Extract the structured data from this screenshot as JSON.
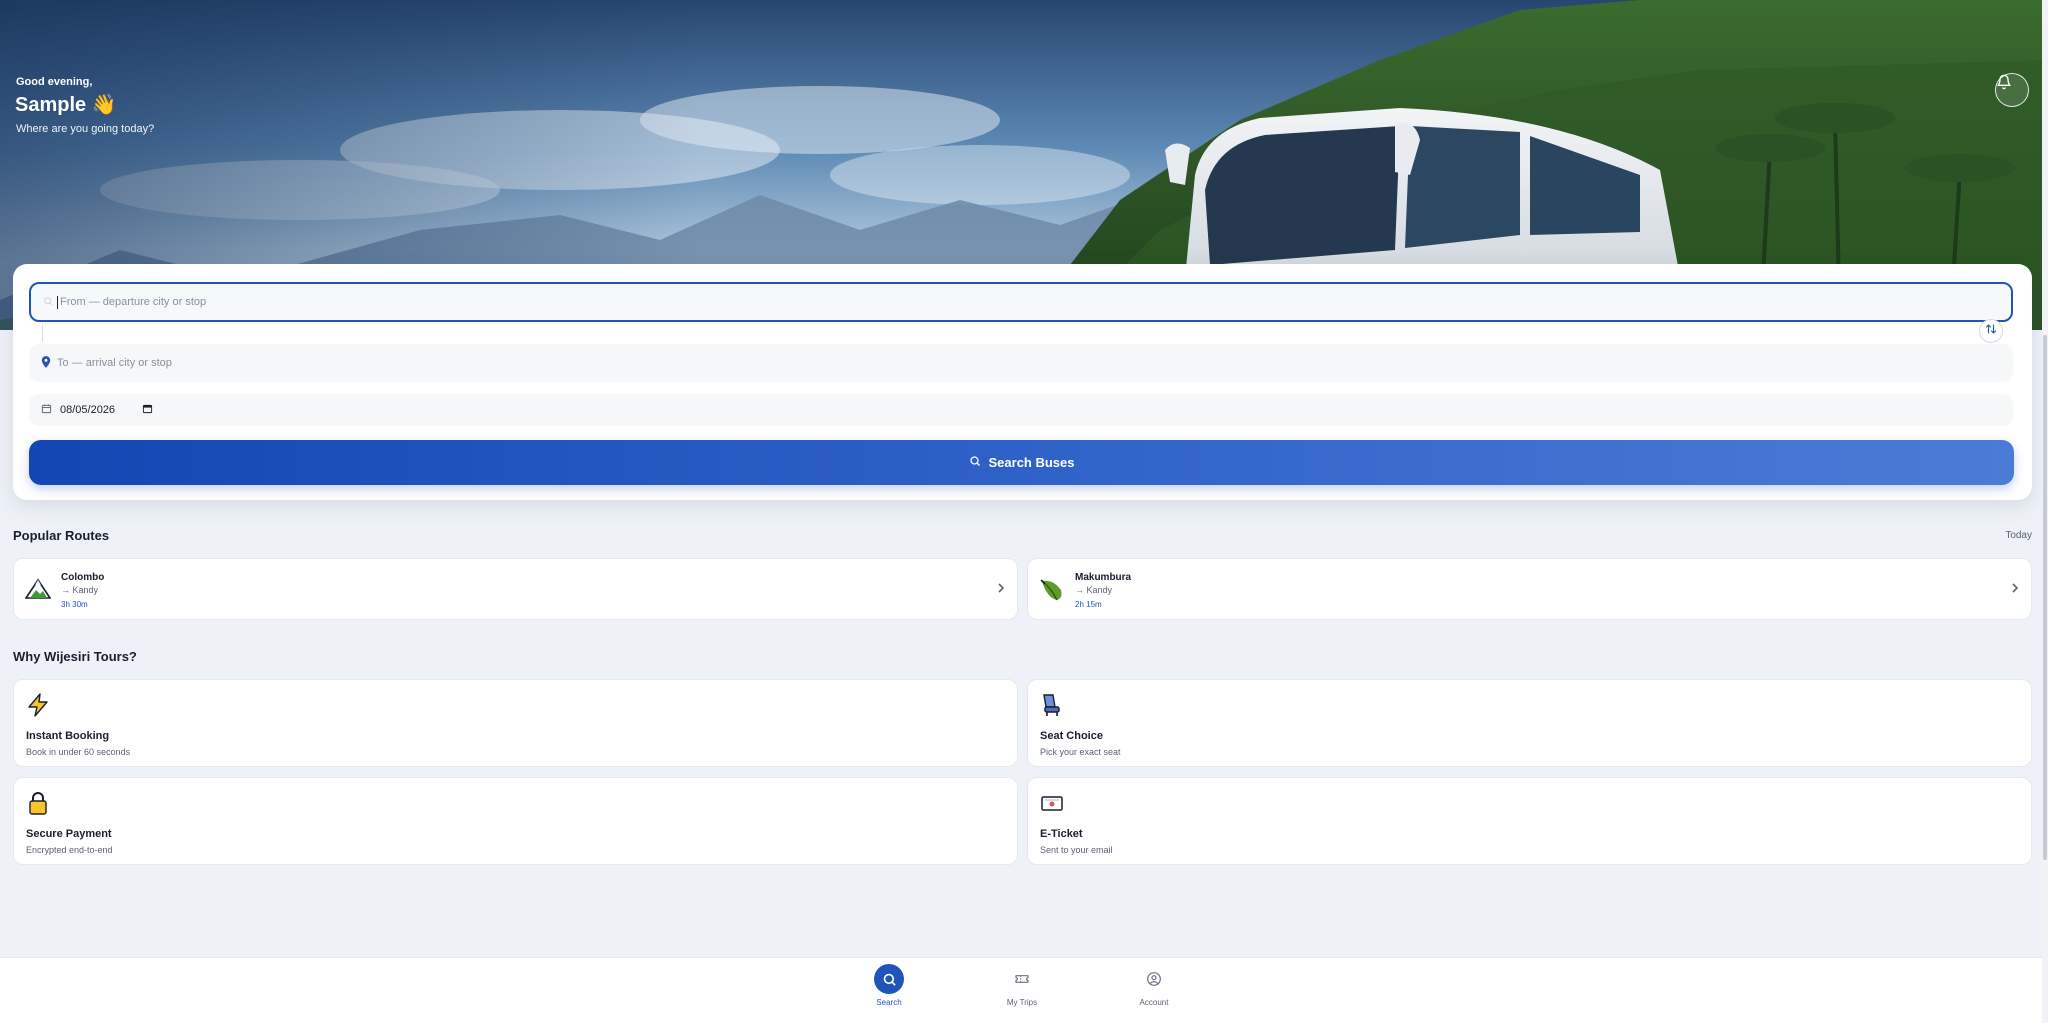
{
  "header": {
    "greeting": "Good evening,",
    "user_name": "Sample 👋",
    "subtitle": "Where are you going today?"
  },
  "search": {
    "from_placeholder": "From — departure city or stop",
    "to_placeholder": "To — arrival city or stop",
    "date_value": "08/05/2026",
    "button_label": "Search Buses"
  },
  "popular_routes": {
    "title": "Popular Routes",
    "right_label": "Today",
    "items": [
      {
        "from": "Colombo",
        "to": "→ Kandy",
        "duration": "3h 30m",
        "icon": "mountain-icon"
      },
      {
        "from": "Makumbura",
        "to": "→ Kandy",
        "duration": "2h 15m",
        "icon": "leaf-icon"
      }
    ]
  },
  "why": {
    "title": "Why Wijesiri Tours?",
    "items": [
      {
        "title": "Instant Booking",
        "subtitle": "Book in under 60 seconds",
        "icon": "lightning-icon"
      },
      {
        "title": "Seat Choice",
        "subtitle": "Pick your exact seat",
        "icon": "seat-icon"
      },
      {
        "title": "Secure Payment",
        "subtitle": "Encrypted end-to-end",
        "icon": "lock-icon"
      },
      {
        "title": "E-Ticket",
        "subtitle": "Sent to your email",
        "icon": "ticket-icon"
      }
    ]
  },
  "nav": {
    "items": [
      {
        "label": "Search",
        "active": true,
        "icon": "search-icon"
      },
      {
        "label": "My Trips",
        "active": false,
        "icon": "ticket-icon"
      },
      {
        "label": "Account",
        "active": false,
        "icon": "account-icon"
      }
    ]
  },
  "colors": {
    "primary": "#1f55b8",
    "background": "#eef2f8",
    "card": "#ffffff"
  }
}
